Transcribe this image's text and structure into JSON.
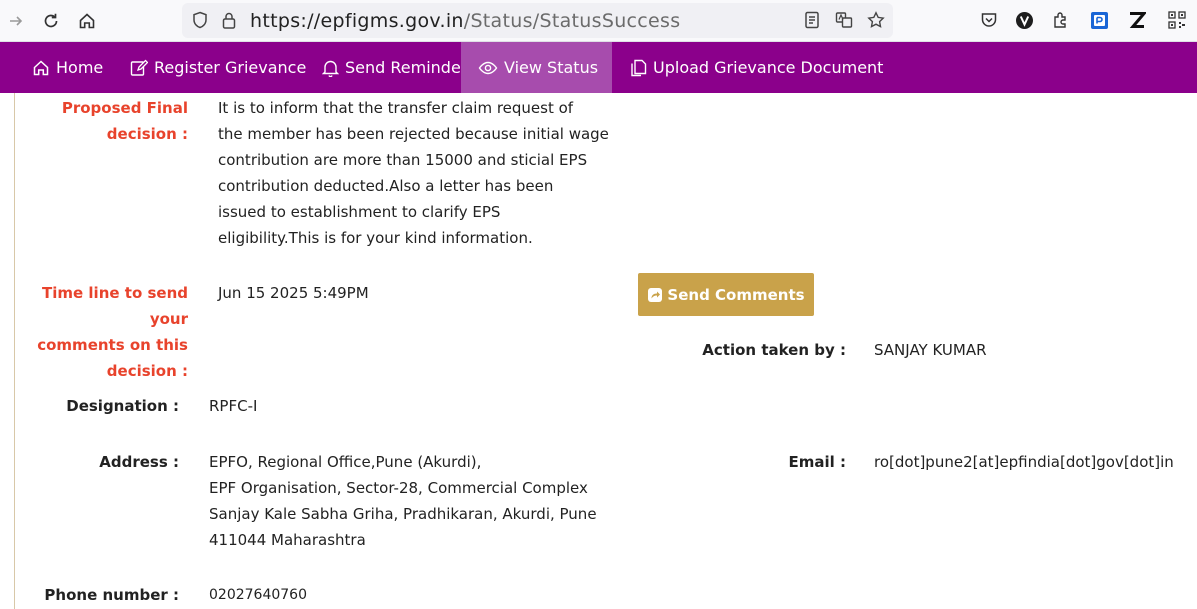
{
  "browser": {
    "url_main": "https://epfigms.gov.in",
    "url_path": "/Status/StatusSuccess"
  },
  "nav": {
    "items": [
      {
        "label": "Home"
      },
      {
        "label": "Register Grievance"
      },
      {
        "label": "Send Reminder"
      },
      {
        "label": "View Status"
      },
      {
        "label": "Upload Grievance Document"
      }
    ]
  },
  "details": {
    "proposed_label_1": "Proposed Final",
    "proposed_label_2": "decision :",
    "proposed_lines": [
      "It is to inform that the transfer claim request of",
      "the member has been rejected because initial wage",
      "contribution are more than 15000 and sticial EPS",
      "contribution deducted.Also a letter has been",
      "issued to establishment to clarify EPS",
      "eligibility.This is for your kind information."
    ],
    "timeline_label_1": "Time line to send your",
    "timeline_label_2": "comments on this",
    "timeline_label_3": "decision :",
    "timeline_value": "Jun 15 2025 5:49PM",
    "send_comments_label": "Send Comments",
    "action_label": "Action taken by :",
    "action_value": "SANJAY KUMAR",
    "designation_label": "Designation :",
    "designation_value": "RPFC-I",
    "address_label": "Address :",
    "address_lines": [
      "EPFO, Regional Office,Pune (Akurdi),",
      "EPF Organisation, Sector-28, Commercial Complex",
      "Sanjay Kale Sabha Griha, Pradhikaran, Akurdi, Pune",
      "411044 Maharashtra"
    ],
    "email_label": "Email :",
    "email_value": "ro[dot]pune2[at]epfindia[dot]gov[dot]in",
    "phone_label": "Phone number :",
    "phone_value": "02027640760"
  }
}
